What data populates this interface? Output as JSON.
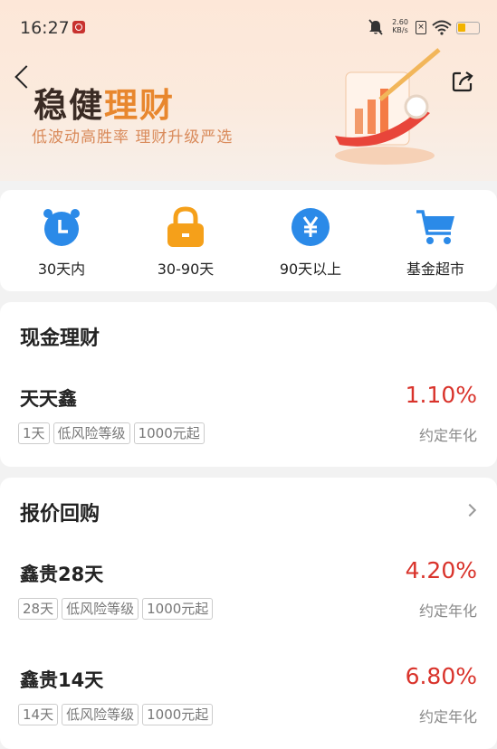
{
  "status_bar": {
    "time": "16:27",
    "net_speed": "2.60",
    "net_unit": "KB/s",
    "battery_level": 0.4
  },
  "header": {
    "title_part1": "稳健",
    "title_part2": "理财",
    "subtitle": "低波动高胜率  理财升级严选"
  },
  "nav": {
    "items": [
      {
        "label": "30天内",
        "icon": "clock-icon"
      },
      {
        "label": "30-90天",
        "icon": "lock-icon"
      },
      {
        "label": "90天以上",
        "icon": "yen-icon"
      },
      {
        "label": "基金超市",
        "icon": "cart-icon"
      }
    ]
  },
  "cash": {
    "title": "现金理财",
    "products": [
      {
        "name": "天天鑫",
        "rate": "1.10%",
        "rate_label": "约定年化",
        "tags": [
          "1天",
          "低风险等级",
          "1000元起"
        ]
      }
    ]
  },
  "repo": {
    "title": "报价回购",
    "products": [
      {
        "name": "鑫贵28天",
        "rate": "4.20%",
        "rate_label": "约定年化",
        "tags": [
          "28天",
          "低风险等级",
          "1000元起"
        ]
      },
      {
        "name": "鑫贵14天",
        "rate": "6.80%",
        "rate_label": "约定年化",
        "tags": [
          "14天",
          "低风险等级",
          "1000元起"
        ]
      }
    ]
  },
  "colors": {
    "accent_orange": "#e8872e",
    "rate_red": "#d9332b",
    "nav_blue": "#2b8ae8",
    "nav_orange": "#f5a01a"
  }
}
